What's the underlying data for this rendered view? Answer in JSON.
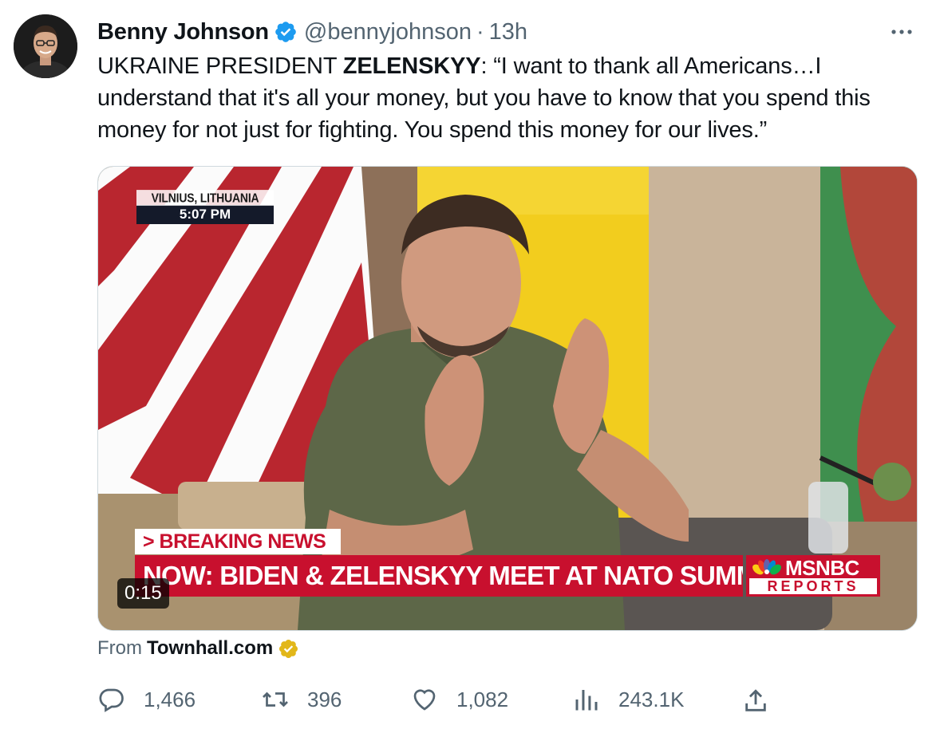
{
  "tweet": {
    "author_name": "Benny Johnson",
    "handle": "@bennyjohnson",
    "separator": "·",
    "time": "13h",
    "text_lead": "UKRAINE PRESIDENT ",
    "text_bold": "ZELENSKYY",
    "text_rest": ": “I want to thank all Americans…I understand that it's all your money, but you have to know that you spend this money for not just for fighting. You spend this money for our lives.”",
    "icons": {
      "verified": "verified-badge-icon",
      "more": "more-options-icon"
    },
    "colors": {
      "verified": "#1d9bf0",
      "text_secondary": "#536471",
      "border": "#cfd9de"
    }
  },
  "video": {
    "dateline_location": "VILNIUS, LITHUANIA",
    "dateline_time": "5:07 PM",
    "breaking_tag": "> BREAKING NEWS",
    "headline": "NOW: BIDEN & ZELENSKYY MEET AT NATO SUMMIT",
    "network": "MSNBC",
    "network_sub": "REPORTS",
    "duration": "0:15",
    "colors": {
      "news_red": "#c8102e"
    }
  },
  "source": {
    "prefix": "From",
    "name": "Townhall.com",
    "badge_color": "#e2b719"
  },
  "actions": {
    "replies": "1,466",
    "reposts": "396",
    "likes": "1,082",
    "views": "243.1K",
    "icons": [
      "reply-icon",
      "repost-icon",
      "like-icon",
      "views-icon",
      "share-icon"
    ]
  }
}
